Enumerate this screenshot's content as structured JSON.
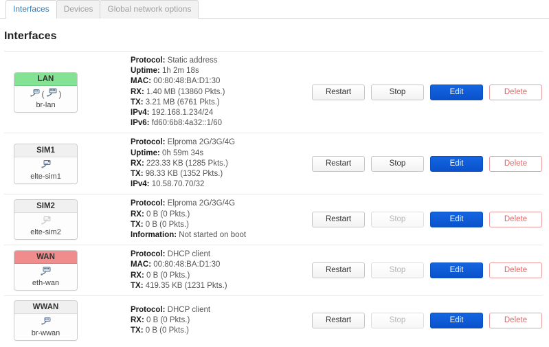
{
  "tabs": [
    {
      "label": "Interfaces",
      "active": true
    },
    {
      "label": "Devices",
      "active": false
    },
    {
      "label": "Global network options",
      "active": false
    }
  ],
  "page": {
    "title": "Interfaces"
  },
  "colors": {
    "accent_blue": "#337ab7",
    "edit_blue": "#0a58d6",
    "delete_red": "#e06464",
    "badge_green": "#84e294",
    "badge_red": "#f08c8c",
    "badge_gray": "#f0f0f0"
  },
  "buttons": {
    "restart": "Restart",
    "stop": "Stop",
    "edit": "Edit",
    "delete": "Delete"
  },
  "labels": {
    "protocol": "Protocol:",
    "uptime": "Uptime:",
    "mac": "MAC:",
    "rx": "RX:",
    "tx": "TX:",
    "ipv4": "IPv4:",
    "ipv6": "IPv6:",
    "information": "Information:"
  },
  "interfaces": [
    {
      "name": "LAN",
      "device": "br-lan",
      "header_color": "green",
      "icon": "bridge-network-icon",
      "icon_dim": false,
      "bridged": true,
      "protocol": "Static address",
      "uptime": "1h 2m 18s",
      "mac": "00:80:48:BA:D1:30",
      "rx": "1.40 MB (13860 Pkts.)",
      "tx": "3.21 MB (6761 Pkts.)",
      "ipv4": "192.168.1.234/24",
      "ipv6": "fd60:6b8:4a32::1/60",
      "information": null,
      "stop_enabled": true
    },
    {
      "name": "SIM1",
      "device": "elte-sim1",
      "header_color": "gray",
      "icon": "modem-icon",
      "icon_dim": false,
      "bridged": false,
      "protocol": "Elproma 2G/3G/4G",
      "uptime": "0h 59m 34s",
      "mac": null,
      "rx": "223.33 KB (1285 Pkts.)",
      "tx": "98.33 KB (1352 Pkts.)",
      "ipv4": "10.58.70.70/32",
      "ipv6": null,
      "information": null,
      "stop_enabled": true
    },
    {
      "name": "SIM2",
      "device": "elte-sim2",
      "header_color": "gray",
      "icon": "modem-icon",
      "icon_dim": true,
      "bridged": false,
      "protocol": "Elproma 2G/3G/4G",
      "uptime": null,
      "mac": null,
      "rx": "0 B (0 Pkts.)",
      "tx": "0 B (0 Pkts.)",
      "ipv4": null,
      "ipv6": null,
      "information": "Not started on boot",
      "stop_enabled": false
    },
    {
      "name": "WAN",
      "device": "eth-wan",
      "header_color": "red",
      "icon": "ethernet-icon",
      "icon_dim": false,
      "bridged": false,
      "protocol": "DHCP client",
      "uptime": null,
      "mac": "00:80:48:BA:D1:30",
      "rx": "0 B (0 Pkts.)",
      "tx": "419.35 KB (1231 Pkts.)",
      "ipv4": null,
      "ipv6": null,
      "information": null,
      "stop_enabled": false
    },
    {
      "name": "WWAN",
      "device": "br-wwan",
      "header_color": "gray",
      "icon": "wireless-network-icon",
      "icon_dim": false,
      "bridged": false,
      "protocol": "DHCP client",
      "uptime": null,
      "mac": null,
      "rx": "0 B (0 Pkts.)",
      "tx": "0 B (0 Pkts.)",
      "ipv4": null,
      "ipv6": null,
      "information": null,
      "stop_enabled": false
    }
  ]
}
